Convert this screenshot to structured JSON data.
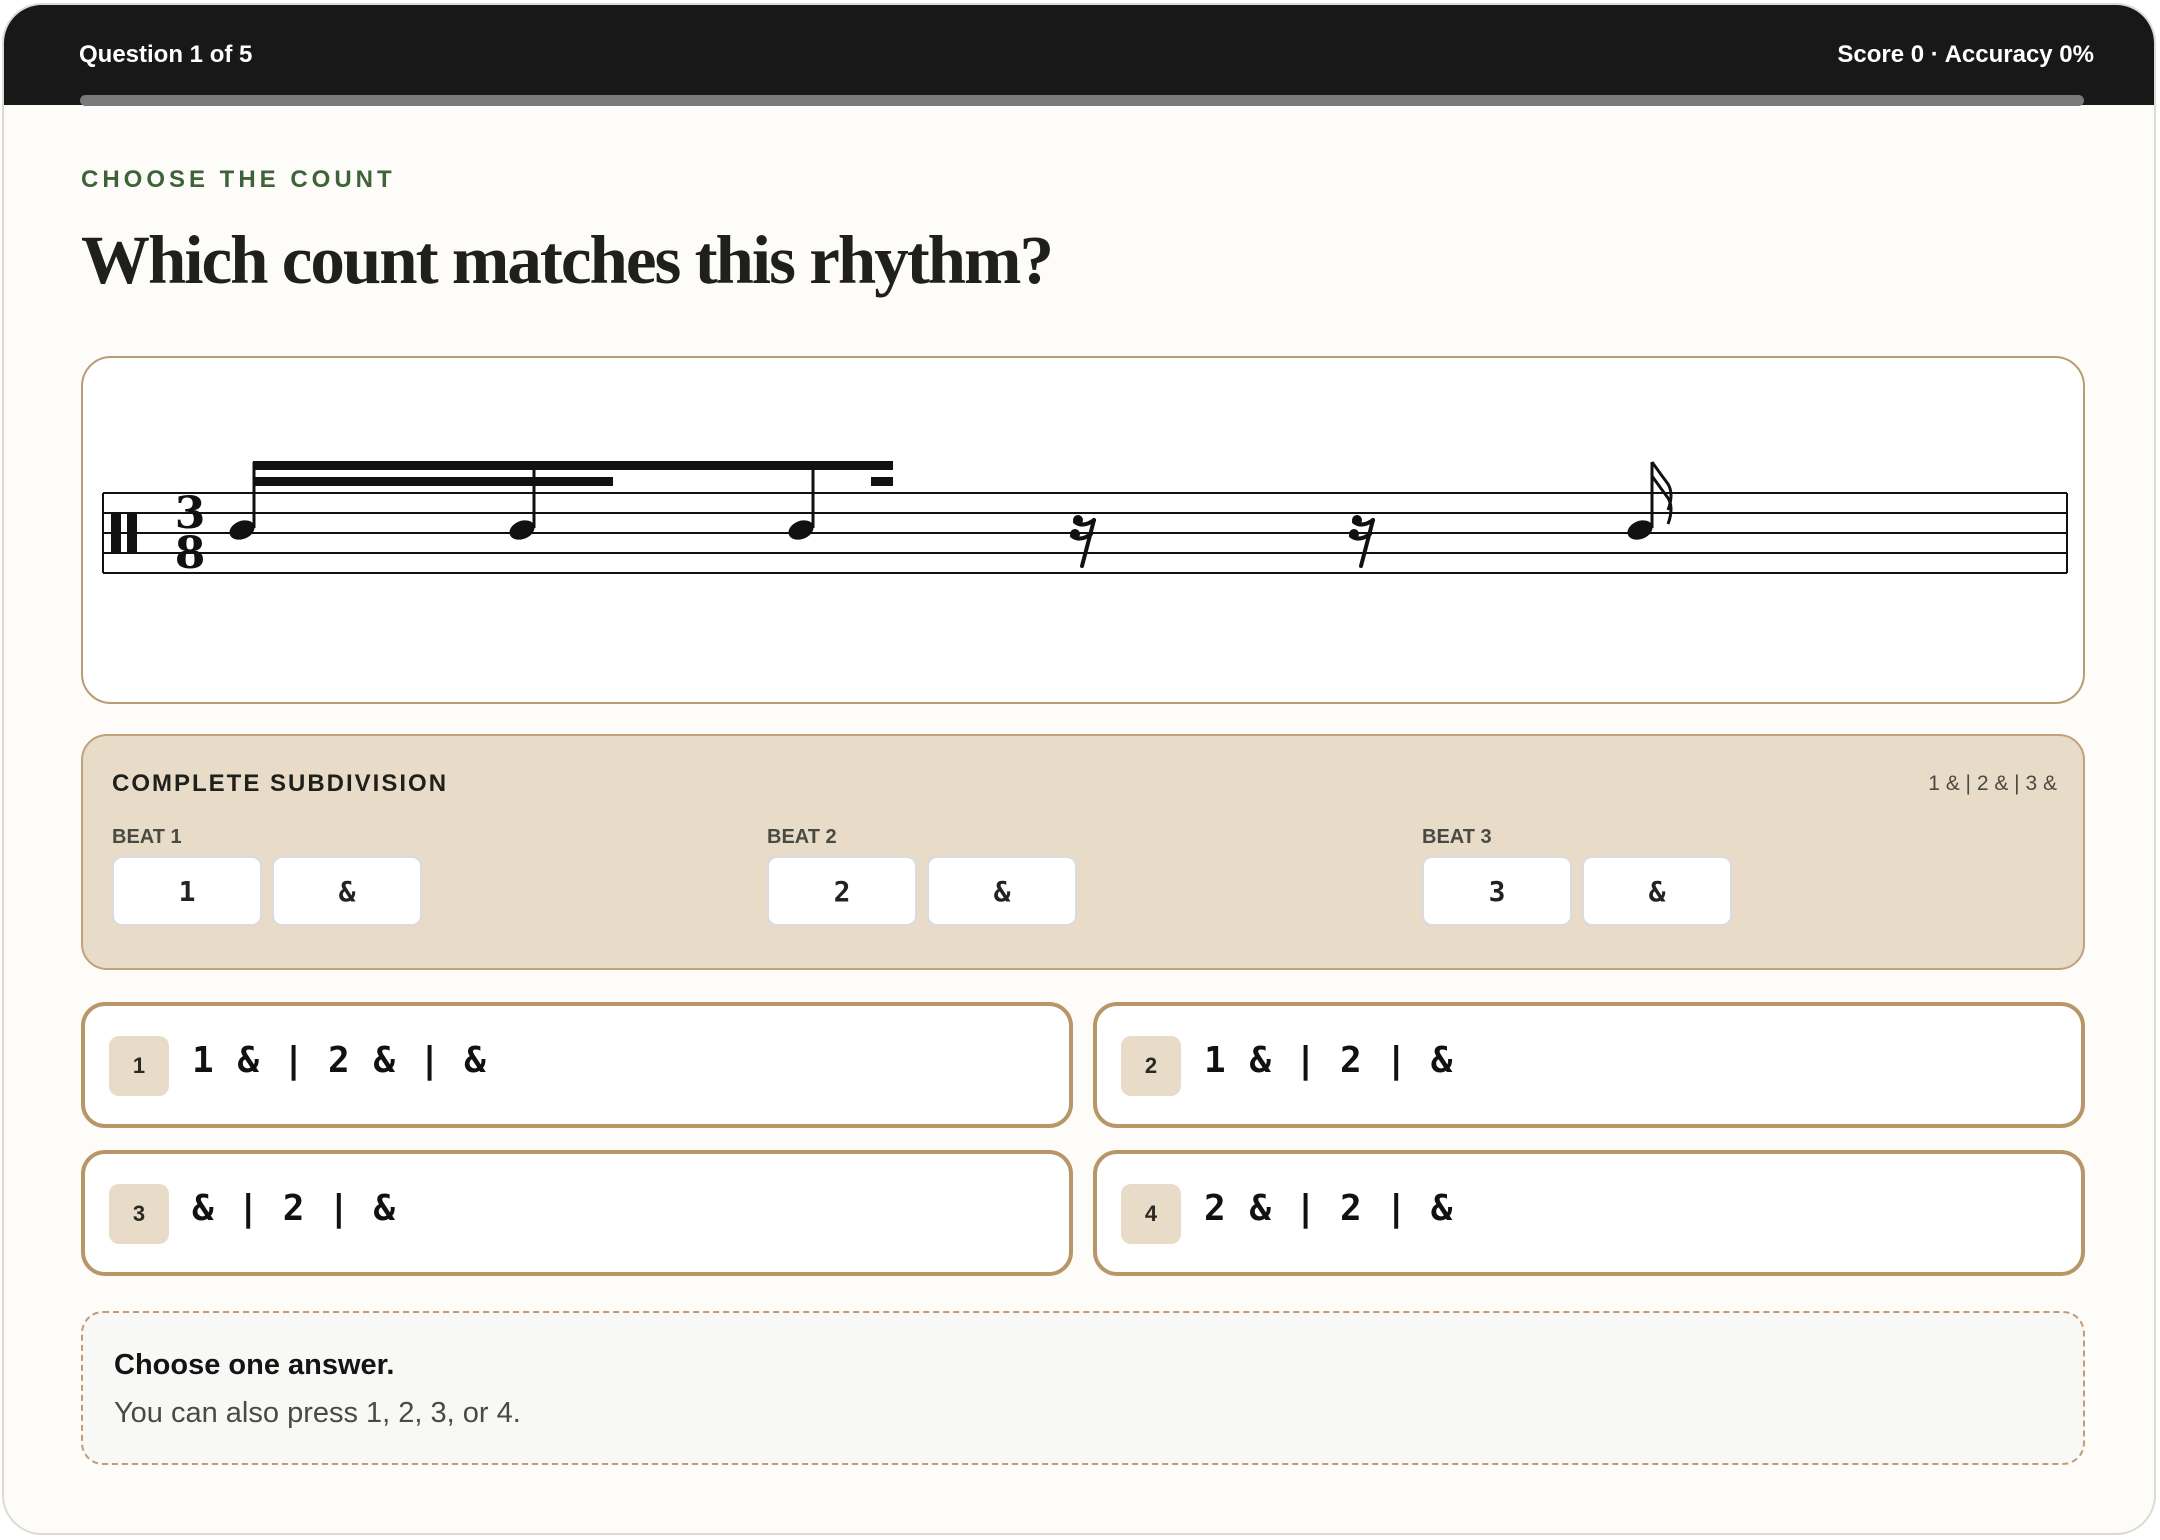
{
  "header": {
    "question_label": "Question 1 of 5",
    "score_label": "Score 0 · Accuracy 0%",
    "progress_fraction": 0
  },
  "prompt": {
    "eyebrow": "CHOOSE THE COUNT",
    "title": "Which count matches this rhythm?"
  },
  "notation": {
    "clef": "percussion",
    "time_signature_top": "3",
    "time_signature_bottom": "8",
    "elements": [
      "sixteenth-note beamed",
      "eighth-note beamed",
      "sixteenth-note beamed",
      "sixteenth-rest",
      "sixteenth-rest",
      "sixteenth-note flagged"
    ]
  },
  "subdivision": {
    "heading": "COMPLETE SUBDIVISION",
    "pattern": "1 & | 2 & | 3 &",
    "beats": [
      {
        "label": "BEAT 1",
        "chips": [
          "1",
          "&"
        ]
      },
      {
        "label": "BEAT 2",
        "chips": [
          "2",
          "&"
        ]
      },
      {
        "label": "BEAT 3",
        "chips": [
          "3",
          "&"
        ]
      }
    ]
  },
  "options": [
    {
      "number": "1",
      "count": "1 & | 2 & | &"
    },
    {
      "number": "2",
      "count": "1 & | 2 | &"
    },
    {
      "number": "3",
      "count": "& | 2 | &"
    },
    {
      "number": "4",
      "count": "2 & | 2 | &"
    }
  ],
  "hint": {
    "title": "Choose one answer.",
    "body": "You can also press 1, 2, 3, or 4."
  },
  "colors": {
    "topbar": "#181818",
    "accent_green": "#3f6339",
    "card_border": "#b89d74",
    "subdivision_bg": "#e8dcc8",
    "option_border": "#b89667"
  }
}
